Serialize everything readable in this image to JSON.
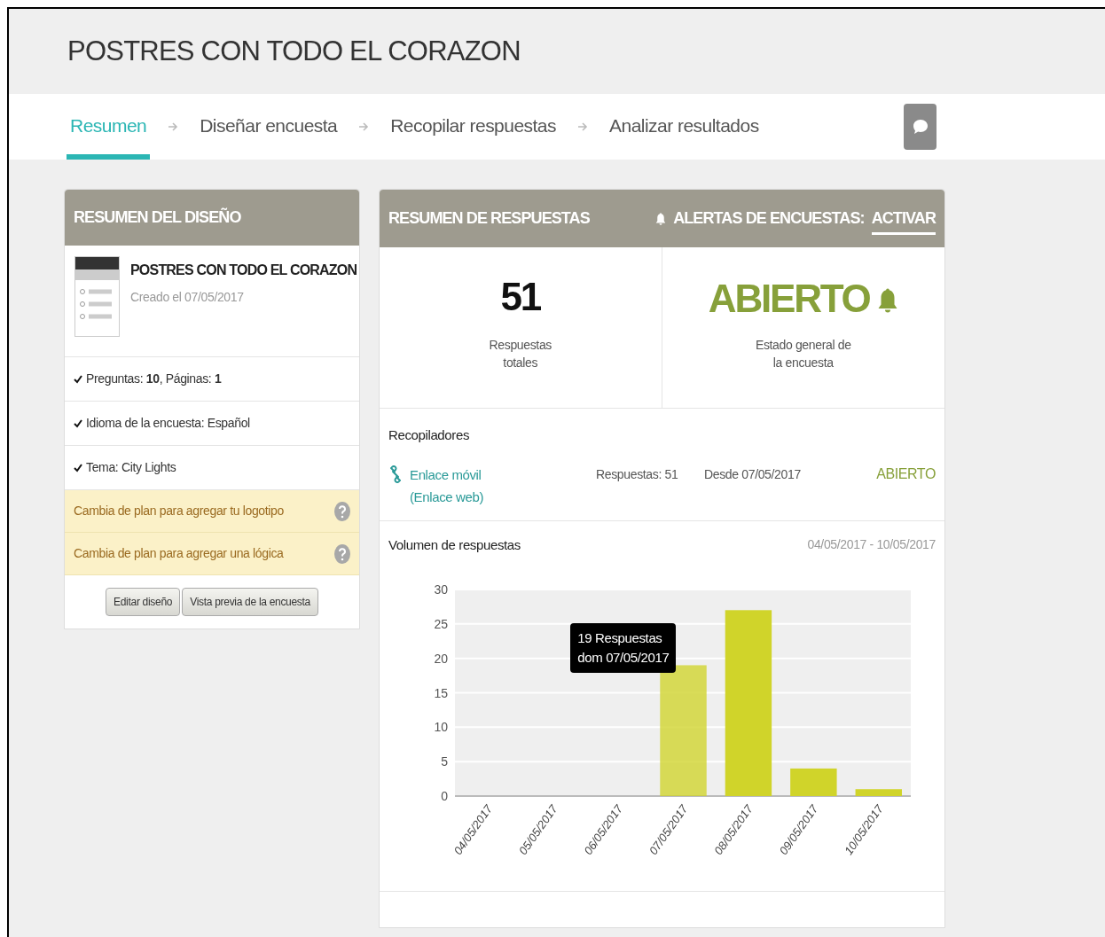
{
  "header": {
    "title": "POSTRES CON TODO EL CORAZON"
  },
  "steps": [
    {
      "label": "Resumen",
      "selected": true
    },
    {
      "label": "Diseñar encuesta",
      "selected": false
    },
    {
      "label": "Recopilar respuestas",
      "selected": false
    },
    {
      "label": "Analizar resultados",
      "selected": false
    }
  ],
  "design_summary": {
    "heading": "RESUMEN DEL DISEÑO",
    "survey_title": "POSTRES CON TODO EL CORAZON",
    "created": "Creado el 07/05/2017",
    "checks": [
      "Preguntas: **10**, Páginas: **1**",
      "Idioma de la encuesta: Español",
      "Tema: City Lights"
    ],
    "upgrades": [
      "Cambia de plan para agregar tu logotipo",
      "Cambia de plan para agregar una lógica"
    ],
    "buttons": [
      "Editar diseño",
      "Vista previa de la encuesta"
    ]
  },
  "response_summary": {
    "heading": "RESUMEN DE RESPUESTAS",
    "alerts_label": "ALERTAS DE ENCUESTAS:",
    "alerts_action": "ACTIVAR",
    "total": "51",
    "total_label": "Respuestas totales",
    "status": "ABIERTO",
    "status_label": "Estado general de la encuesta",
    "collectors_heading": "Recopiladores",
    "collectors": [
      {
        "name": "Enlace móvil",
        "type": "(Enlace web)",
        "responses": "Respuestas: 51",
        "since": "Desde 07/05/2017",
        "status": "ABIERTO"
      }
    ],
    "volume_heading": "Volumen de respuestas",
    "volume_range": "04/05/2017 - 10/05/2017",
    "chart_data": {
      "type": "bar",
      "categories": [
        "04/05/2017",
        "05/05/2017",
        "06/05/2017",
        "07/05/2017",
        "08/05/2017",
        "09/05/2017",
        "10/05/2017"
      ],
      "series": [
        {
          "color": "#d0d42a",
          "values": [
            0,
            0,
            0,
            19,
            27,
            4,
            1
          ]
        }
      ],
      "ylim": [
        0,
        30
      ],
      "yticks": [
        0,
        5,
        10,
        15,
        20,
        25,
        30
      ],
      "grid": true,
      "annotations": [
        {
          "text": "19 Respuestas\ndom 07/05/2017",
          "x": "07/05/2017",
          "y": 19
        }
      ]
    }
  }
}
